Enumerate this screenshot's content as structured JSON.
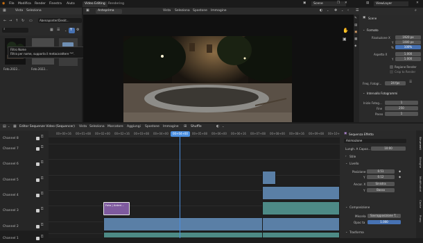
{
  "topbar": {
    "menu": [
      "File",
      "Modifica",
      "Render",
      "Finestra",
      "Aiuto"
    ],
    "workspaces": [
      "Video Editing",
      "Rendering"
    ],
    "scene": "Scene",
    "view_layer": "ViewLayer"
  },
  "file_browser": {
    "menu": [
      "Vista",
      "Seleziona"
    ],
    "path": "Abenaponter/Deskt...",
    "tooltip_line1": "Filtro Nome",
    "tooltip_line2": "Filtra per nome, supporta il metacarattere \"*\".",
    "thumbs": [
      "Foto.2022...",
      "Foto.2022..."
    ]
  },
  "preview": {
    "mode": "Anteprima",
    "menu": [
      "Vista",
      "Seleziona",
      "Spostone",
      "Immagine"
    ]
  },
  "properties": {
    "scene": "Scene",
    "format_title": "Formato",
    "res_x_label": "Risoluzione X",
    "res_x": "1920 px",
    "res_y_label": "Y",
    "res_y": "1080 px",
    "percent_label": "%",
    "percent": "100%",
    "aspect_x_label": "Aspetto X",
    "aspect_x": "1.000",
    "aspect_y_label": "Y",
    "aspect_y": "1.000",
    "render_region": "Regione Render",
    "crop_region": "Crop to Render",
    "fps_label": "Freq. Fotogr...",
    "fps": "24 fps",
    "frame_range_title": "Intervallo Fotogrammi",
    "frame_start_label": "Inizio Fotog...",
    "frame_start": "1",
    "frame_end_label": "Fine",
    "frame_end": "250",
    "frame_step_label": "Passo",
    "frame_step": "1"
  },
  "sequencer": {
    "editor": "Editor Sequenze Video (Sequencer)",
    "menu": [
      "Vista",
      "Seleziona",
      "Marcatore",
      "Aggiungi",
      "Spostone",
      "Immagine"
    ],
    "snapping": "Shuffle",
    "timecodes": [
      "00+00+16",
      "00+01+08",
      "00+02+00",
      "00+02+16",
      "00+03+08",
      "00+04+00",
      "00+04+16",
      "00+05+08",
      "00+06+00",
      "00+06+16",
      "00+07+08",
      "00+08+00",
      "00+08+16",
      "00+09+08",
      "00+10+00"
    ],
    "current_time": "00+04+00",
    "channels": [
      "Channel 8",
      "Channel 7",
      "Channel 6",
      "Channel 5",
      "Channel 4",
      "Channel 3",
      "Channel 2",
      "Channel 1"
    ],
    "text_strip_label": "Foto | Anteri..."
  },
  "side_panel": {
    "header": "Sequenza Effetto",
    "strip_name": "Animazione",
    "length_label": "Lungh. A Capoz...",
    "length": "10:00",
    "style_title": "Stile",
    "layout_title": "Livello",
    "pos_x_label": "Posizione X",
    "pos_x": "0.51",
    "pos_y_label": "Y",
    "pos_y": "0.12",
    "anchor_x_label": "Ancor. X",
    "anchor_x": "Sinistra",
    "anchor_y_label": "Y",
    "anchor_y": "Basso",
    "compositing_title": "Composizione",
    "blend_label": "Miscela",
    "blend": "Sovrapposizione T...",
    "opacity_label": "Opac ta",
    "opacity": "1.000",
    "transform_title": "Trasforma",
    "tabs": [
      "Strumenti",
      "Stringhe",
      "Modificatori",
      "Cache",
      "Proxy"
    ]
  },
  "colors": {
    "meta_strip": "#7e5a9e",
    "image_strip": "#5a7fa6",
    "sound_strip": "#4d8a86",
    "playhead": "#4b8fe0",
    "accent": "#4772b3"
  }
}
